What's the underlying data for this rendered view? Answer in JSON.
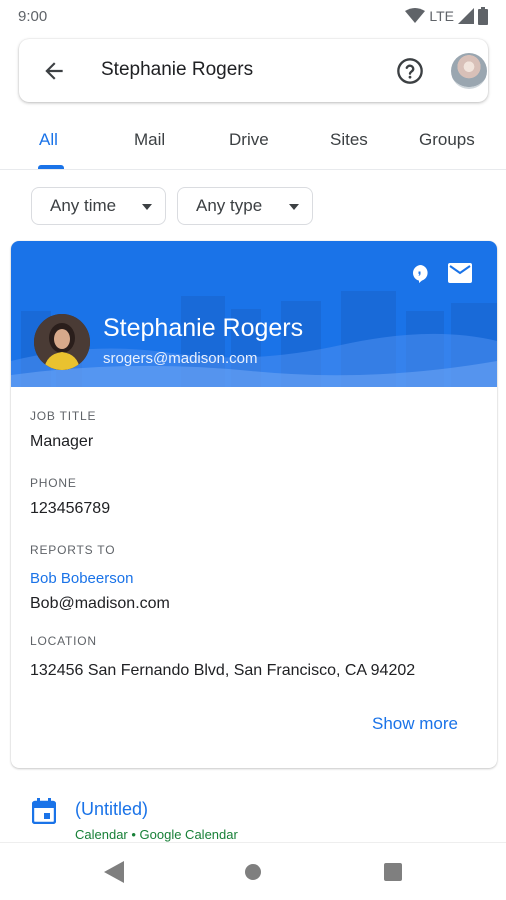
{
  "status_bar": {
    "time": "9:00",
    "network": "LTE"
  },
  "search": {
    "query": "Stephanie Rogers"
  },
  "tabs": [
    {
      "label": "All",
      "active": true
    },
    {
      "label": "Mail",
      "active": false
    },
    {
      "label": "Drive",
      "active": false
    },
    {
      "label": "Sites",
      "active": false
    },
    {
      "label": "Groups",
      "active": false
    }
  ],
  "filters": {
    "time": "Any time",
    "type": "Any type"
  },
  "person": {
    "name": "Stephanie Rogers",
    "email": "srogers@madison.com",
    "job_title_label": "JOB TITLE",
    "job_title": "Manager",
    "phone_label": "PHONE",
    "phone": "123456789",
    "reports_to_label": "REPORTS TO",
    "manager_name": "Bob Bobeerson",
    "manager_email": "Bob@madison.com",
    "location_label": "LOCATION",
    "location": "132456 San Fernando Blvd, San Francisco, CA 94202",
    "show_more": "Show more"
  },
  "result": {
    "title": "(Untitled)",
    "subtitle": "Calendar • Google Calendar"
  },
  "colors": {
    "accent": "#1a73e8",
    "hero_bg": "#1a73e8",
    "subtitle_green": "#188038"
  },
  "icons": {
    "back": "arrow-back-icon",
    "help": "help-circle-icon",
    "chat": "chat-icon",
    "mail": "mail-icon",
    "calendar": "calendar-icon"
  }
}
